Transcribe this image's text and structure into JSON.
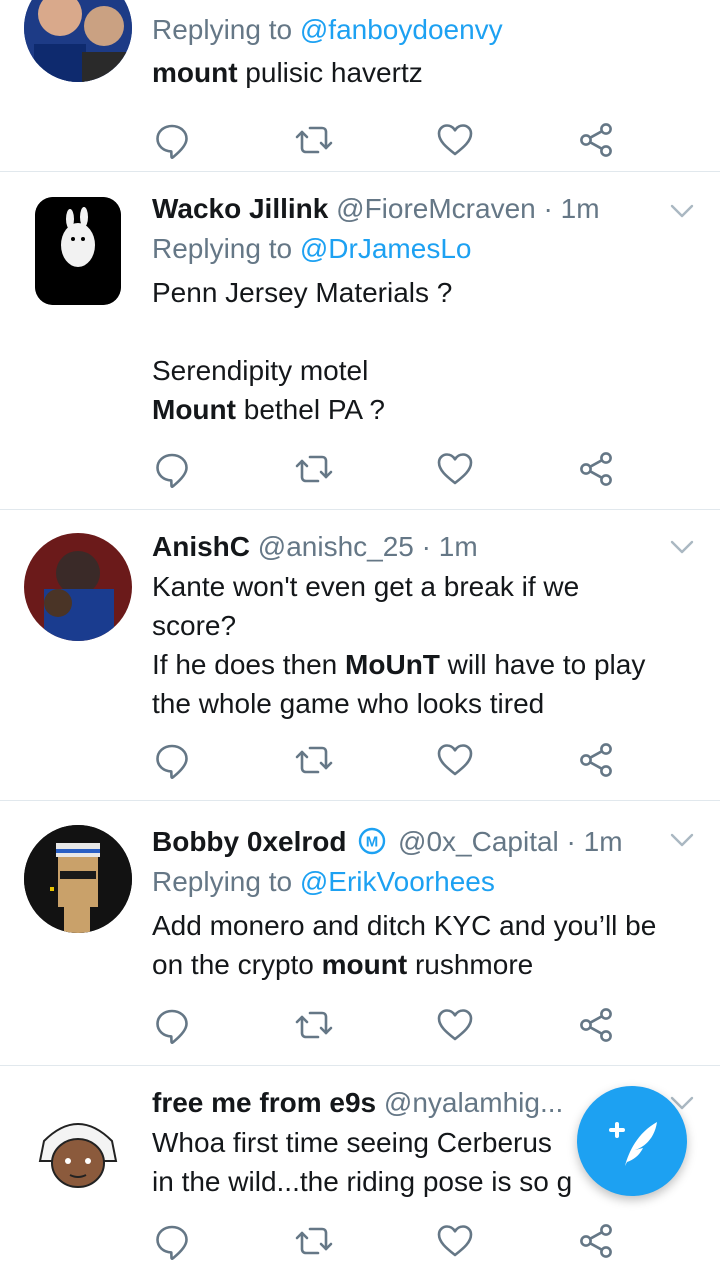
{
  "tweets": [
    {
      "replying_prefix": "Replying to ",
      "replying_to": "@fanboydoenvy",
      "body_bold": "mount",
      "body_rest": " pulisic havertz"
    },
    {
      "name": "Wacko Jillink",
      "handle": "@FioreMcraven",
      "time": " · 1m",
      "replying_prefix": "Replying to ",
      "replying_to": "@DrJamesLo",
      "line1": "Penn Jersey Materials ?",
      "line2": "Serendipity motel",
      "line3_bold": "Mount",
      "line3_rest": " bethel PA ?",
      "avatar_caption": "Plan 9 from Bell Labs"
    },
    {
      "name": "AnishC",
      "handle": "@anishc_25",
      "time": " · 1m",
      "line1": "Kante won't even get a break if we",
      "line2": "score?",
      "line3_pre": "If he does then ",
      "line3_bold": "MoUnT",
      "line3_post": " will have to play",
      "line4": "the whole game who looks tired"
    },
    {
      "name": "Bobby 0xelrod",
      "handle": "@0x_Capital",
      "time": " · 1m",
      "badge": "M",
      "replying_prefix": "Replying to ",
      "replying_to": "@ErikVoorhees",
      "line1": "Add monero and ditch KYC and you’ll be",
      "line2_pre": "on the crypto ",
      "line2_bold": "mount",
      "line2_post": " rushmore"
    },
    {
      "name": "free me from e9s",
      "handle": "@nyalamhig...",
      "line1": "Whoa first time seeing Cerberus",
      "line2": "in the wild...the riding pose is so g"
    }
  ],
  "colors": {
    "accent": "#1da1f2",
    "secondary_text": "#657786",
    "divider": "#e1e8ed"
  },
  "icons": [
    "reply-icon",
    "retweet-icon",
    "like-icon",
    "share-icon",
    "caret-down-icon",
    "compose-icon"
  ]
}
